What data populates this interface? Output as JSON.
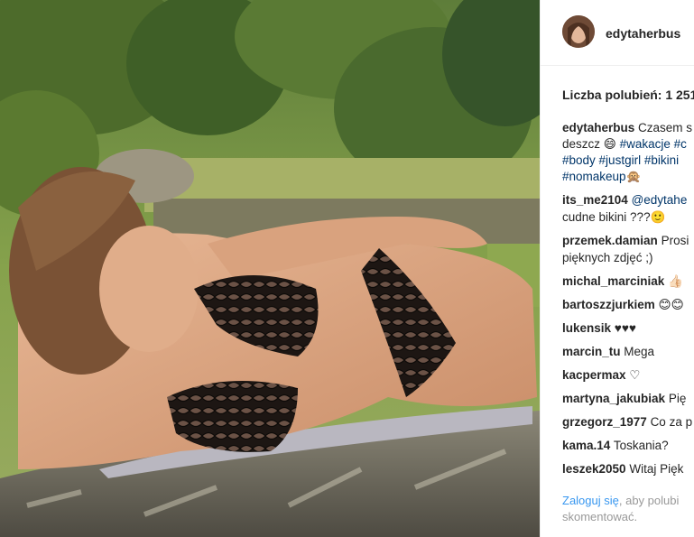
{
  "post": {
    "username": "edytaherbus",
    "likes_text": "Liczba polubień: 1 251",
    "caption": {
      "user": "edytaherbus",
      "line1": "Czasem s",
      "line2_pre": "deszcz 😄 ",
      "line2_tag1": "#wakacje",
      "line2_tag2": " #c",
      "line3_tag1": "#body",
      "line3_tag2": " #justgirl",
      "line3_tag3": " #bikini",
      "line4_tag1": "#nomakeup",
      "line4_emoji": "🙊"
    },
    "comments": [
      {
        "user": "its_me2104",
        "text_mention": "@edytahe",
        "text2": "cudne bikini ???🙂"
      },
      {
        "user": "przemek.damian",
        "text": "Prosi",
        "text2": "pięknych zdjęć ;)"
      },
      {
        "user": "michal_marciniak",
        "text": "👍🏻"
      },
      {
        "user": "bartoszzjurkiem",
        "text": "😊😊"
      },
      {
        "user": "lukensik",
        "text": "♥♥♥"
      },
      {
        "user": "marcin_tu",
        "text": "Mega"
      },
      {
        "user": "kacpermax",
        "text": "♡"
      },
      {
        "user": "martyna_jakubiak",
        "text": "Pię"
      },
      {
        "user": "grzegorz_1977",
        "text": "Co za p"
      },
      {
        "user": "kama.14",
        "text": "Toskania?"
      },
      {
        "user": "leszek2050",
        "text": "Witaj Pięk"
      }
    ],
    "login": {
      "link": "Zaloguj się",
      "rest": ", aby polubi",
      "line2": "skomentować."
    }
  }
}
